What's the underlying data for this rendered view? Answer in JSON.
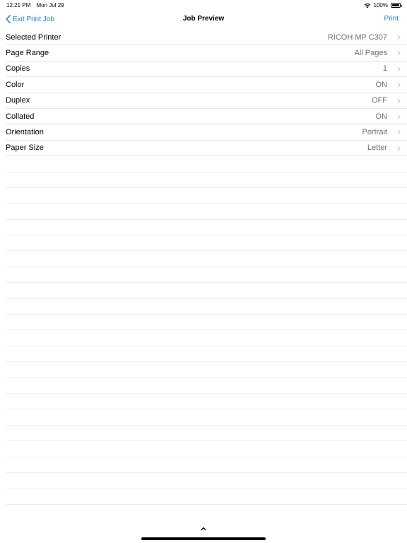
{
  "status": {
    "time": "12:21 PM",
    "date": "Mon Jul 29",
    "battery": "100%"
  },
  "nav": {
    "back_label": "Exit Print Job",
    "title": "Job Preview",
    "action_label": "Print"
  },
  "settings": [
    {
      "label": "Selected Printer",
      "value": "RICOH MP C307"
    },
    {
      "label": "Page Range",
      "value": "All Pages"
    },
    {
      "label": "Copies",
      "value": "1"
    },
    {
      "label": "Color",
      "value": "ON"
    },
    {
      "label": "Duplex",
      "value": "OFF"
    },
    {
      "label": "Collated",
      "value": "ON"
    },
    {
      "label": "Orientation",
      "value": "Portrait"
    },
    {
      "label": "Paper Size",
      "value": "Letter"
    }
  ],
  "colors": {
    "accent": "#1a7cf5",
    "secondary_text": "#6d6d72",
    "separator": "#e5e5ea"
  }
}
